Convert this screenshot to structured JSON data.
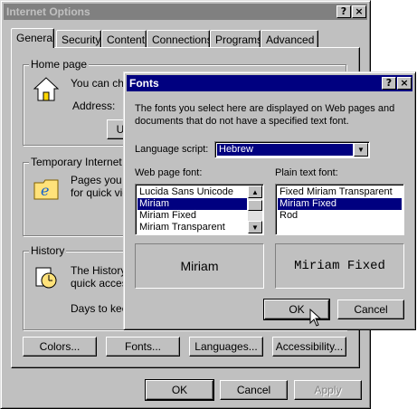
{
  "internet_options": {
    "title": "Internet Options",
    "help_button": "?",
    "close_button": "×",
    "tabs": [
      {
        "label": "General",
        "active": true
      },
      {
        "label": "Security"
      },
      {
        "label": "Content"
      },
      {
        "label": "Connections"
      },
      {
        "label": "Programs"
      },
      {
        "label": "Advanced"
      }
    ],
    "home_page": {
      "label": "Home page",
      "text": "You can cha",
      "address_label": "Address:",
      "use_current_button": "U"
    },
    "temp_files": {
      "label": "Temporary Internet file",
      "text_line1": "Pages you v",
      "text_line2": "for quick vie"
    },
    "history": {
      "label": "History",
      "text_line1": "The History f",
      "text_line2": "quick acces",
      "days_label": "Days to keep"
    },
    "bottom_buttons": {
      "colors": "Colors...",
      "fonts": "Fonts...",
      "languages": "Languages...",
      "accessibility": "Accessibility..."
    },
    "ok": "OK",
    "cancel": "Cancel",
    "apply": "Apply"
  },
  "fonts_dialog": {
    "title": "Fonts",
    "help_button": "?",
    "close_button": "×",
    "description_line1": "The fonts you select here are displayed on Web pages and",
    "description_line2": "documents that do not have a specified text font.",
    "language_script_label": "Language script:",
    "language_script_value": "Hebrew",
    "web_page_font_label": "Web page font:",
    "web_page_fonts": [
      {
        "name": "Lucida Sans Unicode",
        "selected": false
      },
      {
        "name": "Miriam",
        "selected": true
      },
      {
        "name": "Miriam Fixed",
        "selected": false
      },
      {
        "name": "Miriam Transparent",
        "selected": false
      }
    ],
    "plain_text_font_label": "Plain text font:",
    "plain_text_fonts": [
      {
        "name": "Fixed Miriam Transparent",
        "selected": false
      },
      {
        "name": "Miriam Fixed",
        "selected": true
      },
      {
        "name": "Rod",
        "selected": false
      }
    ],
    "web_preview": "Miriam",
    "plain_preview": "Miriam Fixed",
    "ok": "OK",
    "cancel": "Cancel"
  }
}
